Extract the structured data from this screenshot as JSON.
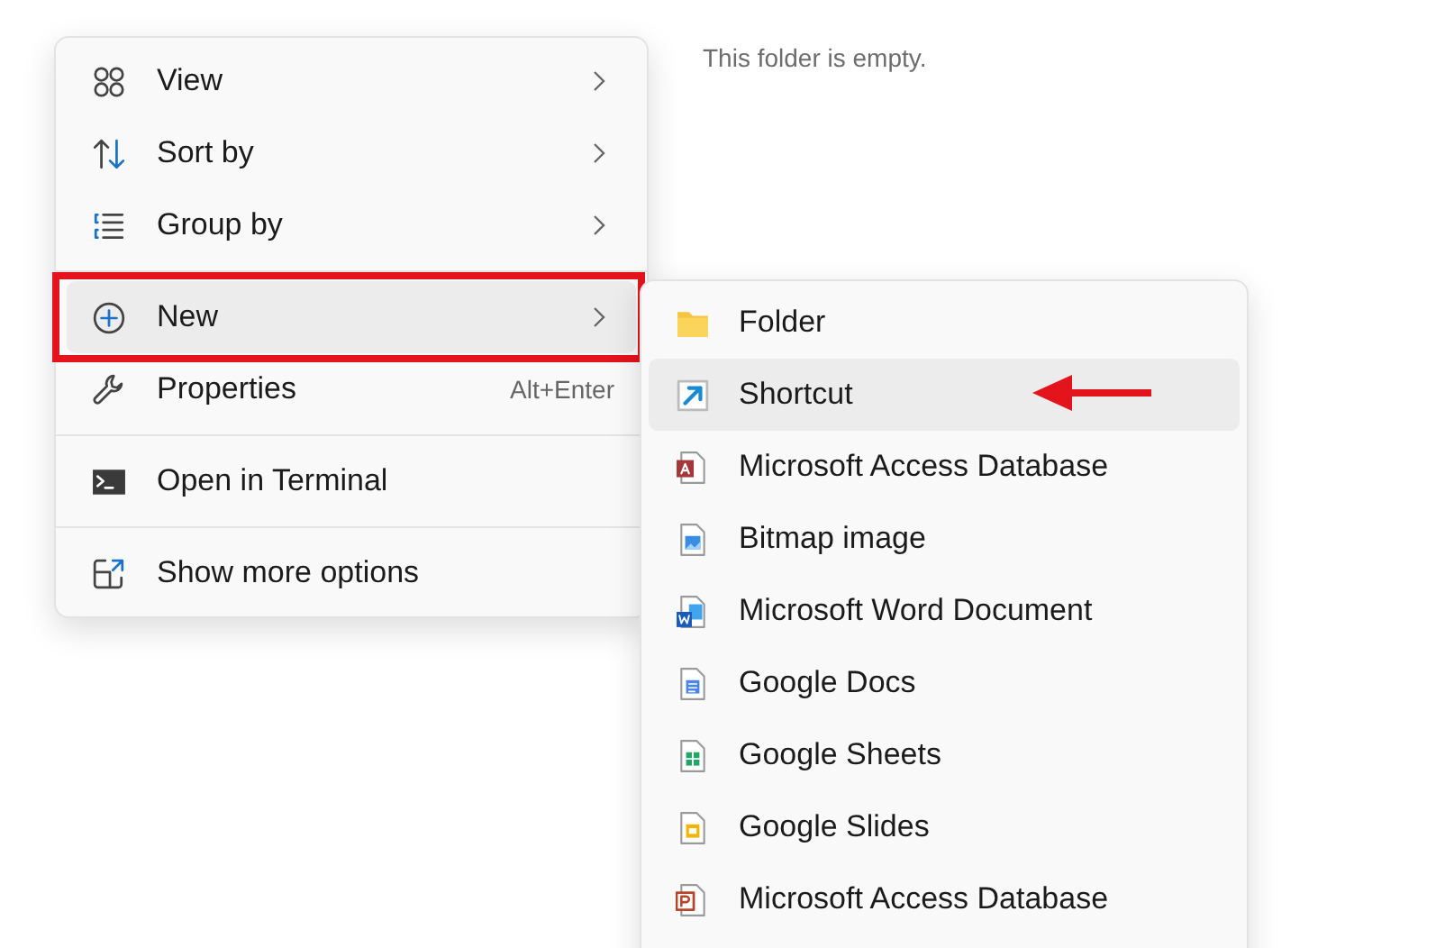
{
  "empty_message": "This folder is empty.",
  "context_menu": {
    "items": [
      {
        "kind": "submenu",
        "label": "View",
        "selected": false,
        "framed": false
      },
      {
        "kind": "submenu",
        "label": "Sort by",
        "selected": false,
        "framed": false
      },
      {
        "kind": "submenu",
        "label": "Group by",
        "selected": false,
        "framed": false
      },
      {
        "kind": "divider"
      },
      {
        "kind": "submenu",
        "label": "New",
        "selected": true,
        "framed": true
      },
      {
        "kind": "shortcut",
        "label": "Properties",
        "shortcut": "Alt+Enter",
        "selected": false,
        "framed": false
      },
      {
        "kind": "divider"
      },
      {
        "kind": "plain",
        "label": "Open in Terminal",
        "selected": false,
        "framed": false
      },
      {
        "kind": "divider"
      },
      {
        "kind": "plain",
        "label": "Show more options",
        "selected": false,
        "framed": false
      }
    ]
  },
  "new_submenu": {
    "items": [
      {
        "label": "Folder",
        "selected": false,
        "arrow_pointed": false
      },
      {
        "label": "Shortcut",
        "selected": true,
        "arrow_pointed": true
      },
      {
        "label": "Microsoft Access Database",
        "selected": false,
        "arrow_pointed": false
      },
      {
        "label": "Bitmap image",
        "selected": false,
        "arrow_pointed": false
      },
      {
        "label": "Microsoft Word Document",
        "selected": false,
        "arrow_pointed": false
      },
      {
        "label": "Google Docs",
        "selected": false,
        "arrow_pointed": false
      },
      {
        "label": "Google Sheets",
        "selected": false,
        "arrow_pointed": false
      },
      {
        "label": "Google Slides",
        "selected": false,
        "arrow_pointed": false
      },
      {
        "label": "Microsoft Access Database",
        "selected": false,
        "arrow_pointed": false
      }
    ]
  }
}
